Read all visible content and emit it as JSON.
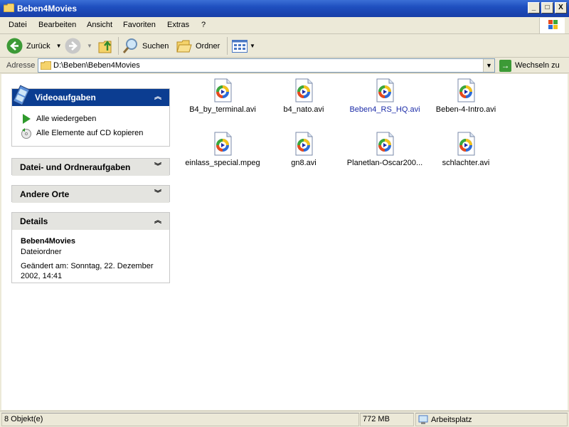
{
  "window": {
    "title": "Beben4Movies",
    "buttons": {
      "minimize": "_",
      "maximize": "□",
      "close": "X"
    }
  },
  "menu": [
    {
      "label": "Datei"
    },
    {
      "label": "Bearbeiten"
    },
    {
      "label": "Ansicht"
    },
    {
      "label": "Favoriten"
    },
    {
      "label": "Extras"
    },
    {
      "label": "?"
    }
  ],
  "toolbar": {
    "back_label": "Zurück",
    "search_label": "Suchen",
    "folders_label": "Ordner"
  },
  "address": {
    "label": "Adresse",
    "path": "D:\\Beben\\Beben4Movies",
    "go_label": "Wechseln zu"
  },
  "tasks": {
    "video": {
      "title": "Videoaufgaben",
      "items": [
        "Alle wiedergeben",
        "Alle Elemente auf CD kopieren"
      ]
    },
    "file_folder": {
      "title": "Datei- und Ordneraufgaben"
    },
    "other_places": {
      "title": "Andere Orte"
    },
    "details": {
      "title": "Details",
      "name": "Beben4Movies",
      "type": "Dateiordner",
      "modified": "Geändert am: Sonntag, 22. Dezember 2002, 14:41"
    }
  },
  "files": [
    {
      "name": "B4_by_terminal.avi"
    },
    {
      "name": "b4_nato.avi"
    },
    {
      "name": "Beben4_RS_HQ.avi"
    },
    {
      "name": "Beben-4-Intro.avi"
    },
    {
      "name": "einlass_special.mpeg"
    },
    {
      "name": "gn8.avi"
    },
    {
      "name": "Planetlan-Oscar200..."
    },
    {
      "name": "schlachter.avi"
    }
  ],
  "status": {
    "count": "8 Objekt(e)",
    "size": "772 MB",
    "zone": "Arbeitsplatz"
  },
  "colors": {
    "titlebar": "#1f4fbf",
    "task_header_active": "#0b3d91",
    "selected_text": "#1c2ca8"
  }
}
